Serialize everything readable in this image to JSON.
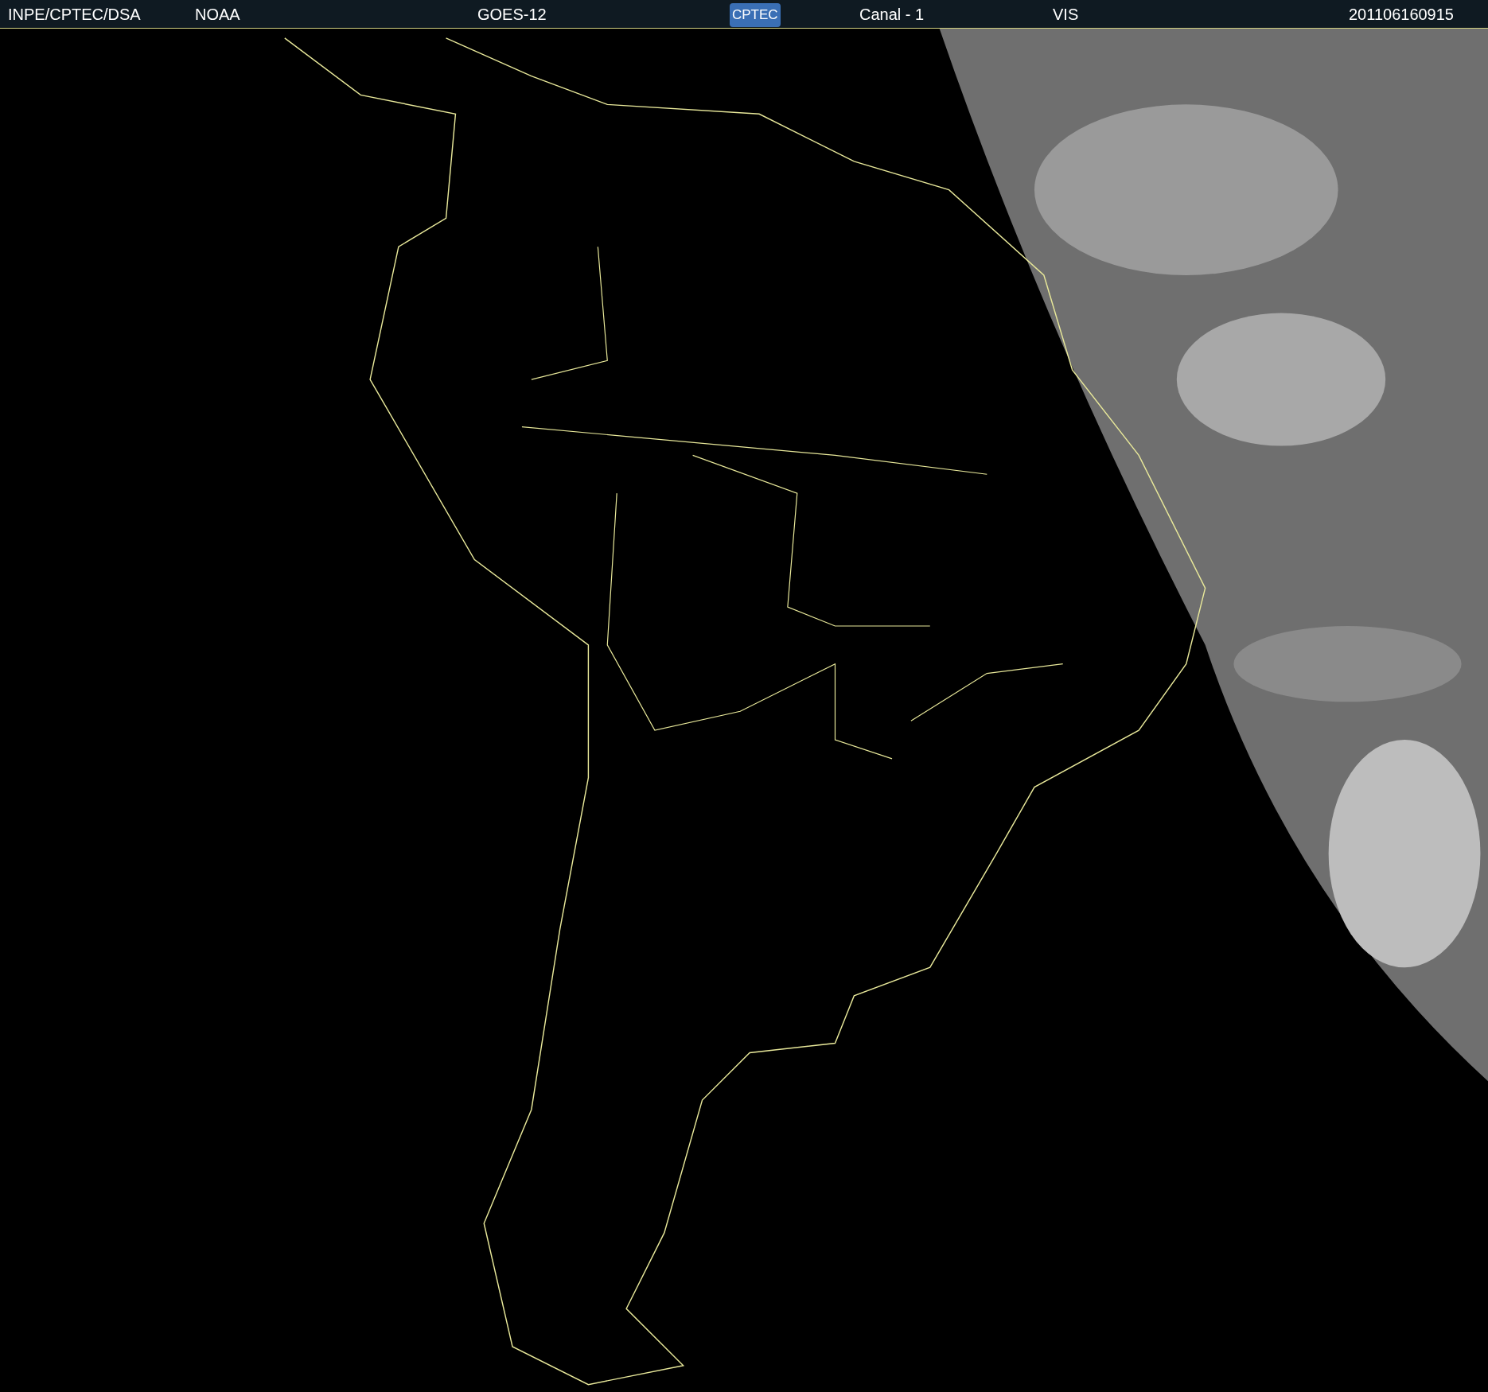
{
  "header": {
    "source": "INPE/CPTEC/DSA",
    "agency": "NOAA",
    "satellite": "GOES-12",
    "logo": "CPTEC",
    "channel": "Canal - 1",
    "band": "VIS",
    "timestamp": "201106160915"
  }
}
